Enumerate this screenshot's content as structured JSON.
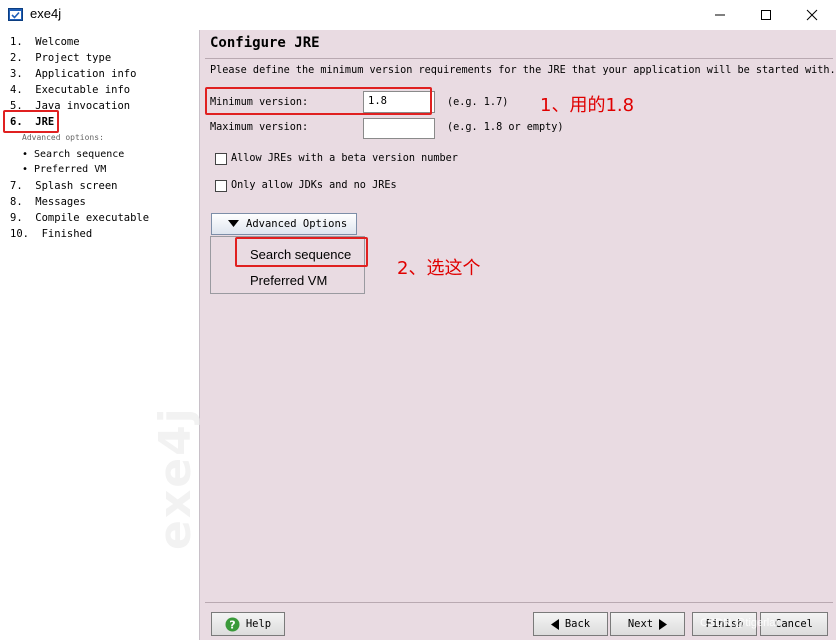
{
  "window": {
    "title": "exe4j"
  },
  "sidebar": {
    "steps": [
      "1.  Welcome",
      "2.  Project type",
      "3.  Application info",
      "4.  Executable info",
      "5.  Java invocation",
      "6.  JRE",
      "7.  Splash screen",
      "8.  Messages",
      "9.  Compile executable",
      "10.  Finished"
    ],
    "advanced_label": "Advanced options:",
    "substeps": [
      "Search sequence",
      "Preferred VM"
    ],
    "watermark": "exe4j"
  },
  "main": {
    "title": "Configure JRE",
    "description": "Please define the minimum version requirements for the JRE that your application will be started with.",
    "min_version_label": "Minimum version:",
    "min_version_value": "1.8",
    "min_version_hint": "(e.g. 1.7)",
    "max_version_label": "Maximum version:",
    "max_version_value": "",
    "max_version_hint": "(e.g. 1.8 or empty)",
    "allow_beta_label": "Allow JREs with a beta version number",
    "only_jdk_label": "Only allow JDKs and no JREs",
    "advanced_button": "Advanced Options",
    "advanced_menu": [
      "Search sequence",
      "Preferred VM"
    ]
  },
  "annotations": {
    "note1": "1、用的1.8",
    "note2": "2、选这个",
    "color": "#e00000"
  },
  "buttons": {
    "help": "Help",
    "back": "Back",
    "next": "Next",
    "finish": "Finish",
    "cancel": "Cancel"
  },
  "watermark_text": "CSDN @tigerlar"
}
